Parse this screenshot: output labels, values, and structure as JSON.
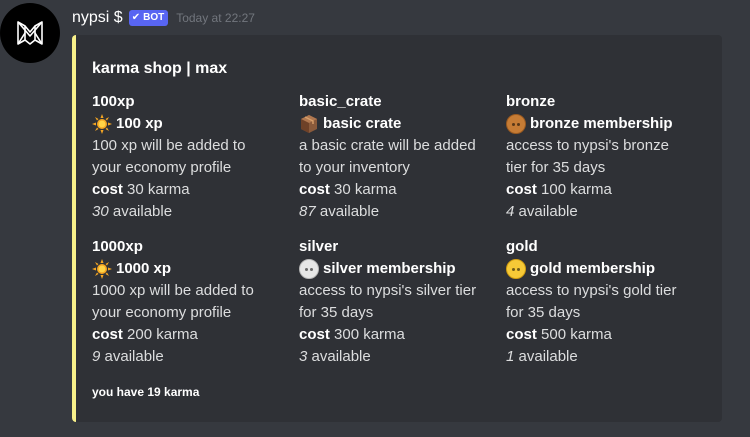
{
  "message": {
    "username": "nypsi $",
    "bot_badge": "BOT",
    "timestamp": "Today at 22:27"
  },
  "embed": {
    "title": "karma shop | max",
    "accent_color": "#f8f08a",
    "footer": "you have 19 karma",
    "items": [
      {
        "id": "100xp",
        "name": "100 xp",
        "emoji": "sun-icon",
        "desc1": "100 xp will be added to",
        "desc2": "your economy profile",
        "cost_label": "cost",
        "cost": "30 karma",
        "available_count": "30",
        "available_label": "available"
      },
      {
        "id": "basic_crate",
        "name": "basic crate",
        "emoji": "crate-icon",
        "desc1": "a basic crate will be added",
        "desc2": "to your inventory",
        "cost_label": "cost",
        "cost": "30 karma",
        "available_count": "87",
        "available_label": "available"
      },
      {
        "id": "bronze",
        "name": "bronze membership",
        "emoji": "bronze-coin-icon",
        "desc1": "access to nypsi's bronze",
        "desc2": "tier for 35 days",
        "cost_label": "cost",
        "cost": "100 karma",
        "available_count": "4",
        "available_label": "available"
      },
      {
        "id": "1000xp",
        "name": "1000 xp",
        "emoji": "sun-icon",
        "desc1": "1000 xp will be added to",
        "desc2": "your economy profile",
        "cost_label": "cost",
        "cost": "200 karma",
        "available_count": "9",
        "available_label": "available"
      },
      {
        "id": "silver",
        "name": "silver membership",
        "emoji": "silver-coin-icon",
        "desc1": "access to nypsi's silver tier",
        "desc2": "for 35 days",
        "cost_label": "cost",
        "cost": "300 karma",
        "available_count": "3",
        "available_label": "available"
      },
      {
        "id": "gold",
        "name": "gold membership",
        "emoji": "gold-coin-icon",
        "desc1": "access to nypsi's gold tier",
        "desc2": "for 35 days",
        "cost_label": "cost",
        "cost": "500 karma",
        "available_count": "1",
        "available_label": "available"
      }
    ]
  }
}
